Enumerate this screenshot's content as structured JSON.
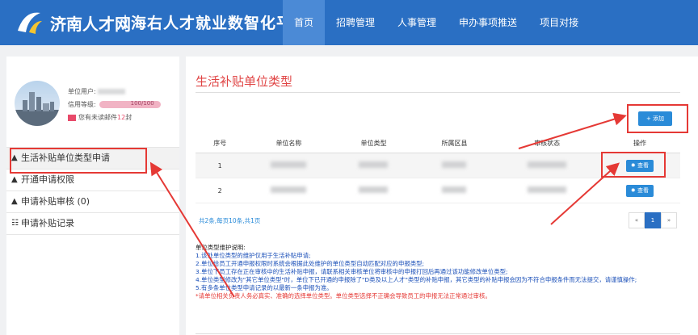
{
  "header": {
    "logo_text": "济南人才网",
    "separator": "|",
    "platform_title": "海右人才就业数智化平台",
    "nav": [
      {
        "label": "首页",
        "active": true
      },
      {
        "label": "招聘管理",
        "active": false
      },
      {
        "label": "人事管理",
        "active": false
      },
      {
        "label": "申办事项推送",
        "active": false
      },
      {
        "label": "项目对接",
        "active": false
      }
    ]
  },
  "sidebar": {
    "user_label": "单位用户:",
    "credit_label": "信用等级:",
    "credit_value": "100/100",
    "mail_prefix": "您有未读邮件",
    "mail_count": "12",
    "mail_suffix": "封",
    "menu": [
      {
        "label": "生活补贴单位类型申请",
        "icon": "home-icon",
        "active": true
      },
      {
        "label": "开通申请权限",
        "icon": "home-icon",
        "active": false
      },
      {
        "label": "申请补贴审核",
        "icon": "home-icon",
        "count": "(0)",
        "active": false
      },
      {
        "label": "申请补贴记录",
        "icon": "list-icon",
        "active": false
      }
    ]
  },
  "main": {
    "title": "生活补贴单位类型",
    "add_button": "+ 添加",
    "table": {
      "headers": [
        "序号",
        "单位名称",
        "单位类型",
        "所属区县",
        "审核状态",
        "操作"
      ],
      "rows": [
        {
          "index": "1",
          "action": "查看"
        },
        {
          "index": "2",
          "action": "查看"
        }
      ]
    },
    "pagination": {
      "info": "共2条,每页10条,共1页",
      "prev": "«",
      "current": "1",
      "next": "»"
    },
    "notes": {
      "heading": "单位类型维护说明:",
      "lines": [
        "1.该处单位类型的维护仅用于生活补贴申请;",
        "2.单位给员工开通申报权限时系统会根据此处维护的单位类型自动匹配对应的申报类型;",
        "3.单位下员工存在正在审核中的生活补贴申报，请联系相关审核单位将审核中的申报打回后再通过该功能修改单位类型;",
        "4.单位类型修改为\"其它单位类型\"时，单位下已开通的申报除了\"D类及以上人才\"类型的补贴申报，其它类型的补贴申报会因为不符合申报条件而无法提交，请谨慎操作;",
        "5.有多条单位类型申请记录的以最新一条申报为准。"
      ],
      "warning": "*请单位相关负责人务必真实、准确的选择单位类型。单位类型选择不正确会导致员工的申报无法正常通过审核。"
    }
  },
  "colors": {
    "header_bg": "#2a6fc3",
    "accent_red": "#e53935",
    "button_blue": "#2a8bd8"
  }
}
